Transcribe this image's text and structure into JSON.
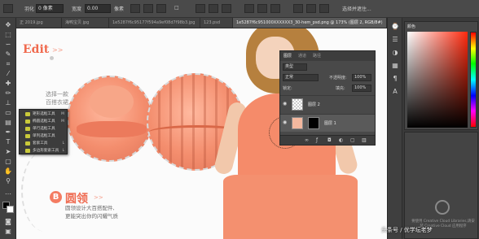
{
  "options_bar": {
    "feather_label": "羽化",
    "feather_value": "0 像素",
    "width_label": "宽度",
    "width_value": "0.00",
    "unit": "像素",
    "flag": "□",
    "misc": "选择并遮住..."
  },
  "tabs": [
    {
      "label": "正 2019.jpg"
    },
    {
      "label": "海鸭宝贝 jpg"
    },
    {
      "label": "1e5287f6c95177f594a9ef08d7f98b3.jpg"
    },
    {
      "label": "123.psd"
    },
    {
      "label": "1e5287f6c951000XXXXXX3_30-hem_psd.png @ 173% (图层 2, RGB/8#)"
    }
  ],
  "toolbar": {
    "tools": [
      "move-icon",
      "marquee-icon",
      "lasso-icon",
      "quick-select-icon",
      "crop-icon",
      "eyedropper-icon",
      "healing-icon",
      "brush-icon",
      "stamp-icon",
      "history-brush-icon",
      "eraser-icon",
      "gradient-icon",
      "blur-icon",
      "dodge-icon",
      "pen-icon",
      "type-icon",
      "path-select-icon",
      "shape-icon",
      "hand-icon",
      "zoom-icon"
    ]
  },
  "flyout": {
    "items": [
      {
        "label": "矩形选框工具",
        "key": "M"
      },
      {
        "label": "椭圆选框工具",
        "key": "M"
      },
      {
        "label": "单行选框工具",
        "key": ""
      },
      {
        "label": "单列选框工具",
        "key": ""
      },
      {
        "label": "套索工具",
        "key": "L"
      },
      {
        "label": "多边形套索工具",
        "key": "L"
      }
    ]
  },
  "canvas": {
    "title_top": "Edit",
    "title_arrows": ">>",
    "feature_text": [
      "选择一款",
      "百搭衣裙,"
    ],
    "badge": "B",
    "collar_title": "圆领",
    "collar_arrows": ">>",
    "collar_desc": [
      "圆领设计大百搭配件,",
      "更能突出你的闪耀气质"
    ]
  },
  "layers_panel": {
    "tabs": [
      "图层",
      "通道",
      "路径"
    ],
    "kind_label": "类型",
    "blend_mode": "正常",
    "opacity_label": "不透明度:",
    "opacity_value": "100%",
    "lock_label": "锁定:",
    "fill_label": "填充:",
    "fill_value": "100%",
    "layers": [
      {
        "name": "图层 2"
      },
      {
        "name": "图层 1"
      }
    ]
  },
  "right_dock": {
    "color_title": "颜色",
    "libraries_text": "要使用 Creative Cloud Libraries,请安装 Creative Cloud 应用程序"
  },
  "watermark": "头条号 / 优学坛老梦"
}
